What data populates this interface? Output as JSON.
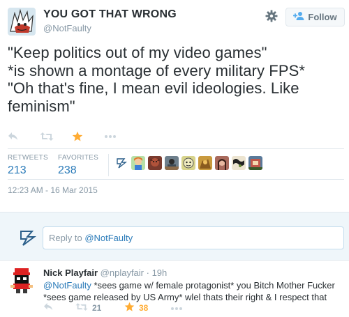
{
  "tweet": {
    "display_name": "YOU GOT THAT WRONG",
    "handle": "@NotFaulty",
    "follow_label": "Follow",
    "text_lines": [
      "\"Keep politics out of my video games\"",
      "*is shown a montage of every military FPS*",
      "\"Oh that's fine, I mean evil ideologies. Like",
      "feminism\""
    ],
    "retweets_label": "RETWEETS",
    "retweets_count": "213",
    "favorites_label": "FAVORITES",
    "favorites_count": "238",
    "timestamp": "12:23 AM - 16 Mar 2015"
  },
  "reply_box": {
    "prefix": "Reply to ",
    "mention": "@NotFaulty"
  },
  "reply_tweet": {
    "name": "Nick Playfair",
    "handle": "@nplayfair",
    "time": "· 19h",
    "mention": "@NotFaulty",
    "text": " *sees game w/ female protagonist* you Bitch Mother Fucker *sees game released by US Army* wlel thats their right & I respect that",
    "retweet_count": "21",
    "favorite_count": "38"
  },
  "colors": {
    "link": "#2b7bb9",
    "muted": "#8899a6",
    "star": "#ffac33",
    "text": "#292f33"
  },
  "icons": [
    "reply-icon",
    "retweet-icon",
    "star-icon",
    "more-icon",
    "gear-icon",
    "add-user-icon"
  ]
}
